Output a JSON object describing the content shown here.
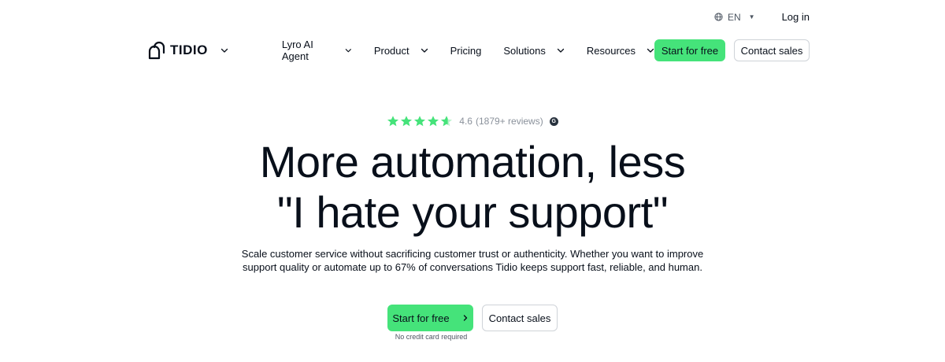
{
  "header": {
    "language": "EN",
    "login_label": "Log in",
    "logo_text": "TIDIO",
    "nav": [
      {
        "label": "Lyro AI Agent",
        "has_dropdown": true
      },
      {
        "label": "Product",
        "has_dropdown": true
      },
      {
        "label": "Pricing",
        "has_dropdown": false
      },
      {
        "label": "Solutions",
        "has_dropdown": true
      },
      {
        "label": "Resources",
        "has_dropdown": true
      }
    ],
    "start_label": "Start for free",
    "contact_label": "Contact sales"
  },
  "hero": {
    "rating_value": "4.6",
    "rating_reviews": "(1879+ reviews)",
    "stars": 4.6,
    "review_source_icon": "g2-icon",
    "headline_line1": "More automation, less",
    "headline_line2": "\"I hate your support\"",
    "subtitle_line1": "Scale customer service without sacrificing customer trust or authenticity. Whether you want to improve",
    "subtitle_line2": "support quality or automate up to 67% of conversations Tidio keeps support fast, reliable, and human.",
    "cta_primary": "Start for free",
    "cta_secondary": "Contact sales",
    "cta_note": "No credit card required"
  },
  "colors": {
    "accent": "#45E37A",
    "text": "#080F1A",
    "muted": "#8a919b",
    "border": "#cfd3d8"
  }
}
